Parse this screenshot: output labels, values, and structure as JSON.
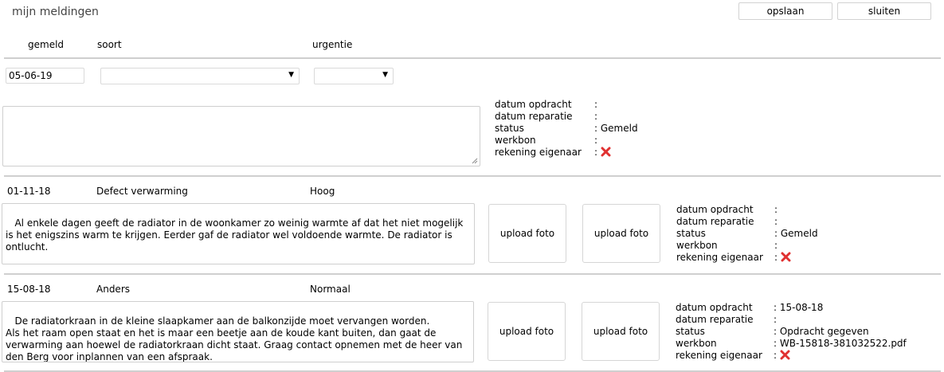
{
  "header": {
    "title": "mijn meldingen",
    "save_label": "opslaan",
    "close_label": "sluiten"
  },
  "columns": {
    "gemeld": "gemeld",
    "soort": "soort",
    "urgentie": "urgentie"
  },
  "new": {
    "date_value": "05-06-19",
    "soort_value": "",
    "urgentie_value": "",
    "description": "",
    "info": {
      "datum_opdracht_label": "datum opdracht",
      "datum_opdracht_value": "",
      "datum_reparatie_label": "datum reparatie",
      "datum_reparatie_value": "",
      "status_label": "status",
      "status_value": "Gemeld",
      "werkbon_label": "werkbon",
      "werkbon_value": "",
      "rekening_label": "rekening eigenaar"
    }
  },
  "meldingen": [
    {
      "date": "01-11-18",
      "soort": "Defect verwarming",
      "urgentie": "Hoog",
      "description": " Al enkele dagen geeft de radiator in de woonkamer zo weinig warmte af dat het niet mogelijk is het enigszins warm te krijgen. Eerder gaf de radiator wel voldoende warmte. De radiator is ontlucht.",
      "upload1": "upload foto",
      "upload2": "upload foto",
      "info": {
        "datum_opdracht_label": "datum opdracht",
        "datum_opdracht_value": "",
        "datum_reparatie_label": "datum reparatie",
        "datum_reparatie_value": "",
        "status_label": "status",
        "status_value": "Gemeld",
        "werkbon_label": "werkbon",
        "werkbon_value": "",
        "rekening_label": "rekening eigenaar"
      }
    },
    {
      "date": "15-08-18",
      "soort": "Anders",
      "urgentie": "Normaal",
      "description": " De radiatorkraan in de kleine slaapkamer aan de balkonzijde moet vervangen worden.\nAls het raam open staat en het is maar een beetje aan de koude kant buiten, dan gaat de verwarming aan hoewel de radiatorkraan dicht staat. Graag contact opnemen met de heer van den Berg voor inplannen van een afspraak.",
      "upload1": "upload foto",
      "upload2": "upload foto",
      "info": {
        "datum_opdracht_label": "datum opdracht",
        "datum_opdracht_value": "15-08-18",
        "datum_reparatie_label": "datum reparatie",
        "datum_reparatie_value": "",
        "status_label": "status",
        "status_value": "Opdracht gegeven",
        "werkbon_label": "werkbon",
        "werkbon_value": "WB-15818-381032522.pdf",
        "rekening_label": "rekening eigenaar"
      }
    }
  ],
  "colors": {
    "divider": "#cfcfcf",
    "red_x": "#e03131"
  },
  "icons": {
    "rekening": "red-x-icon",
    "dropdown": "caret-down-icon",
    "resize": "resize-grip-icon"
  }
}
